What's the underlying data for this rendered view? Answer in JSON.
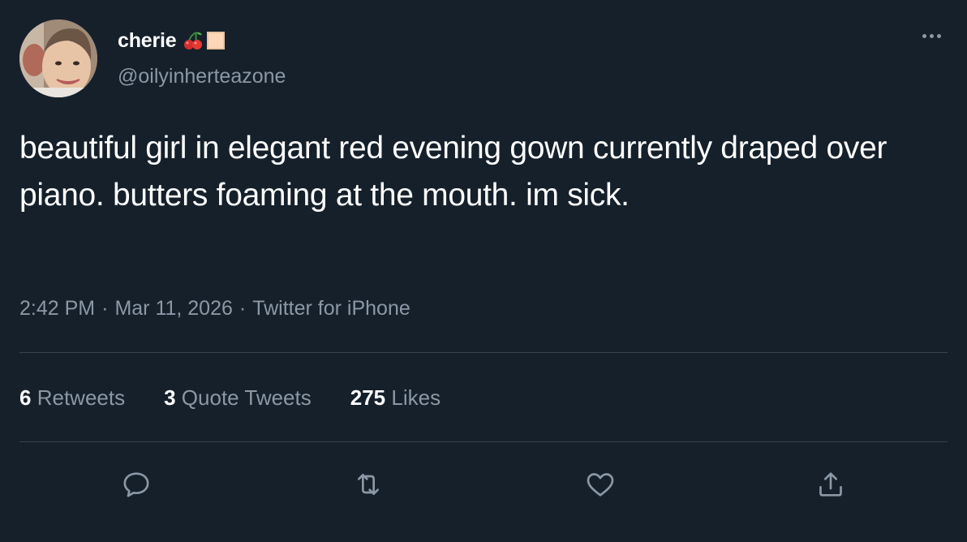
{
  "user": {
    "display_name": "cherie",
    "handle": "@oilyinherteazone",
    "name_emojis": [
      "cherry-icon",
      "square-icon"
    ]
  },
  "tweet": {
    "text": "beautiful girl in elegant red evening gown currently draped over piano. butters foaming at the mouth. im sick.",
    "time": "2:42 PM",
    "date": "Mar 11, 2026",
    "separator": "·",
    "source": "Twitter for iPhone"
  },
  "stats": {
    "retweets": {
      "count": "6",
      "label": "Retweets"
    },
    "quotes": {
      "count": "3",
      "label": "Quote Tweets"
    },
    "likes": {
      "count": "275",
      "label": "Likes"
    }
  },
  "actions": [
    "reply-icon",
    "retweet-icon",
    "like-icon",
    "share-icon"
  ],
  "colors": {
    "background": "#15202b",
    "text": "#ffffff",
    "secondary": "#8b98a5",
    "divider": "#38444d"
  }
}
